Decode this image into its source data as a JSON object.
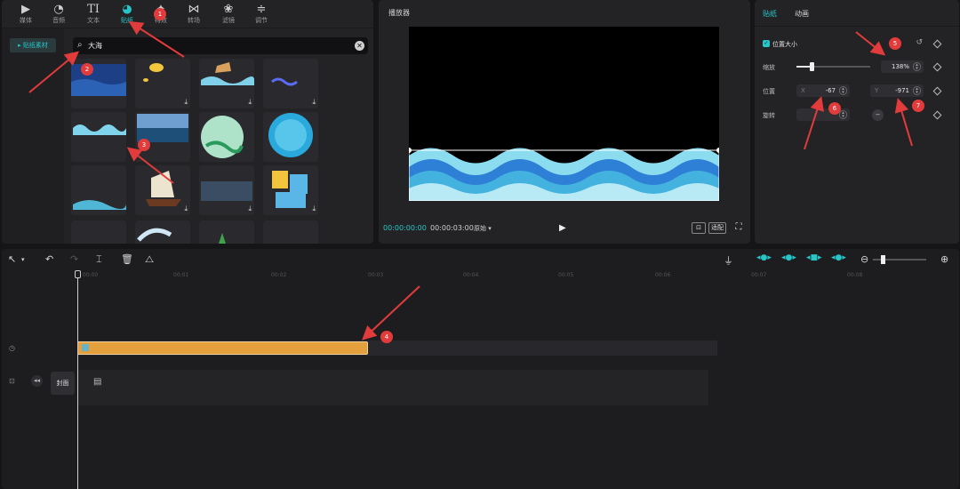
{
  "toolbar": {
    "tools": [
      {
        "label": "媒体",
        "icon": "media-icon"
      },
      {
        "label": "音频",
        "icon": "audio-icon"
      },
      {
        "label": "文本",
        "icon": "text-icon"
      },
      {
        "label": "贴纸",
        "icon": "sticker-icon",
        "active": true
      },
      {
        "label": "特效",
        "icon": "effects-icon"
      },
      {
        "label": "转场",
        "icon": "transition-icon"
      },
      {
        "label": "滤镜",
        "icon": "filter-icon"
      },
      {
        "label": "调节",
        "icon": "adjust-icon"
      }
    ]
  },
  "sidebar": {
    "item": "▸ 贴纸素材"
  },
  "search": {
    "value": "大海"
  },
  "player": {
    "title": "播放器",
    "time_current": "00:00:00:00",
    "time_total": "00:00:03:00",
    "ratio_label": "原始 ▾",
    "btn_a": "⊡",
    "btn_b": "适配",
    "fullscreen": "⛶"
  },
  "props": {
    "tab_sticker": "贴纸",
    "tab_animation": "动画",
    "section": "位置大小",
    "scale_label": "缩放",
    "scale_value": "138%",
    "scale_fraction": 0.21,
    "position_label": "位置",
    "x_axis": "X",
    "x_value": "-67",
    "y_axis": "Y",
    "y_value": "-971",
    "rotation_label": "旋转"
  },
  "timeline": {
    "ticks": [
      "00:00",
      "00:01",
      "00:02",
      "00:03",
      "00:04",
      "00:05",
      "00:06",
      "00:07",
      "00:08"
    ],
    "cover_label": "封面",
    "zoom_level": 0.15
  },
  "markers": [
    "1",
    "2",
    "3",
    "4",
    "5",
    "6",
    "7"
  ],
  "colors": {
    "accent": "#27c5c8",
    "clip": "#e3a03d",
    "marker": "#e23b3b"
  }
}
